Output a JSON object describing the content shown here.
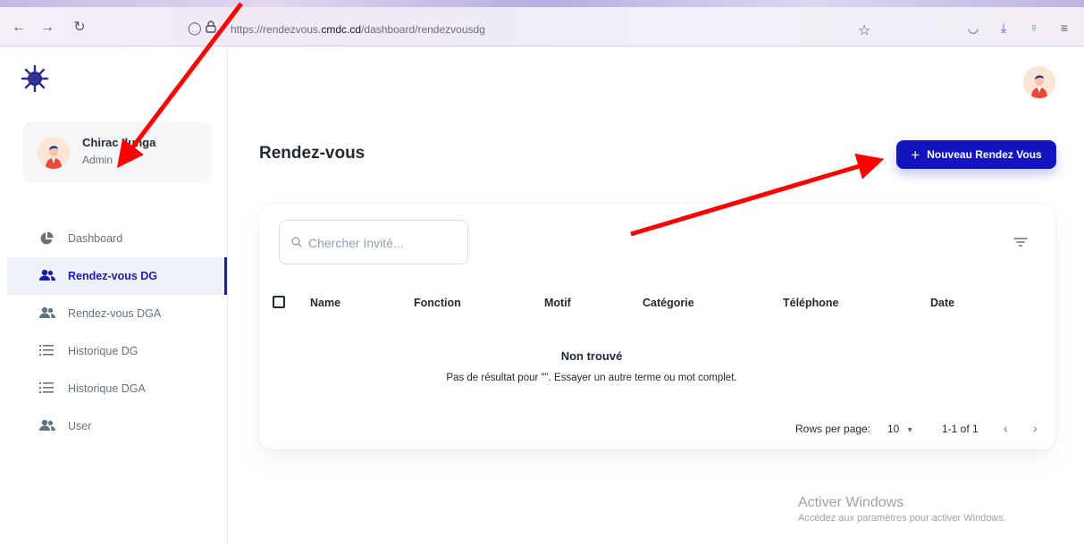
{
  "browser": {
    "url_prefix": "https://rendezvous.",
    "url_domain": "cmdc.cd",
    "url_path": "/dashboard/rendezvousdg"
  },
  "sidebar": {
    "account": {
      "name": "Chirac Ilunga",
      "role": "Admin"
    },
    "items": [
      {
        "label": "Dashboard",
        "icon": "pie-chart-icon",
        "active": false
      },
      {
        "label": "Rendez-vous DG",
        "icon": "users-icon",
        "active": true
      },
      {
        "label": "Rendez-vous DGA",
        "icon": "users-icon",
        "active": false
      },
      {
        "label": "Historique DG",
        "icon": "list-icon",
        "active": false
      },
      {
        "label": "Historique DGA",
        "icon": "list-icon",
        "active": false
      },
      {
        "label": "User",
        "icon": "users-icon",
        "active": false
      }
    ]
  },
  "main": {
    "title": "Rendez-vous",
    "new_button": "Nouveau Rendez Vous",
    "search": {
      "placeholder": "Chercher Invité..."
    },
    "columns": [
      "Name",
      "Fonction",
      "Motif",
      "Catégorie",
      "Téléphone",
      "Date"
    ],
    "empty": {
      "title": "Non trouvé",
      "message": "Pas de résultat pour  \"\". Essayer un autre terme ou mot complet."
    },
    "pagination": {
      "rows_label": "Rows per page:",
      "rows_value": "10",
      "range": "1-1 of 1"
    }
  },
  "watermark": {
    "line1": "Activer Windows",
    "line2": "Accédez aux paramètres pour activer Windows."
  },
  "colors": {
    "primary": "#1414bf",
    "annotation": "#ff0000"
  }
}
